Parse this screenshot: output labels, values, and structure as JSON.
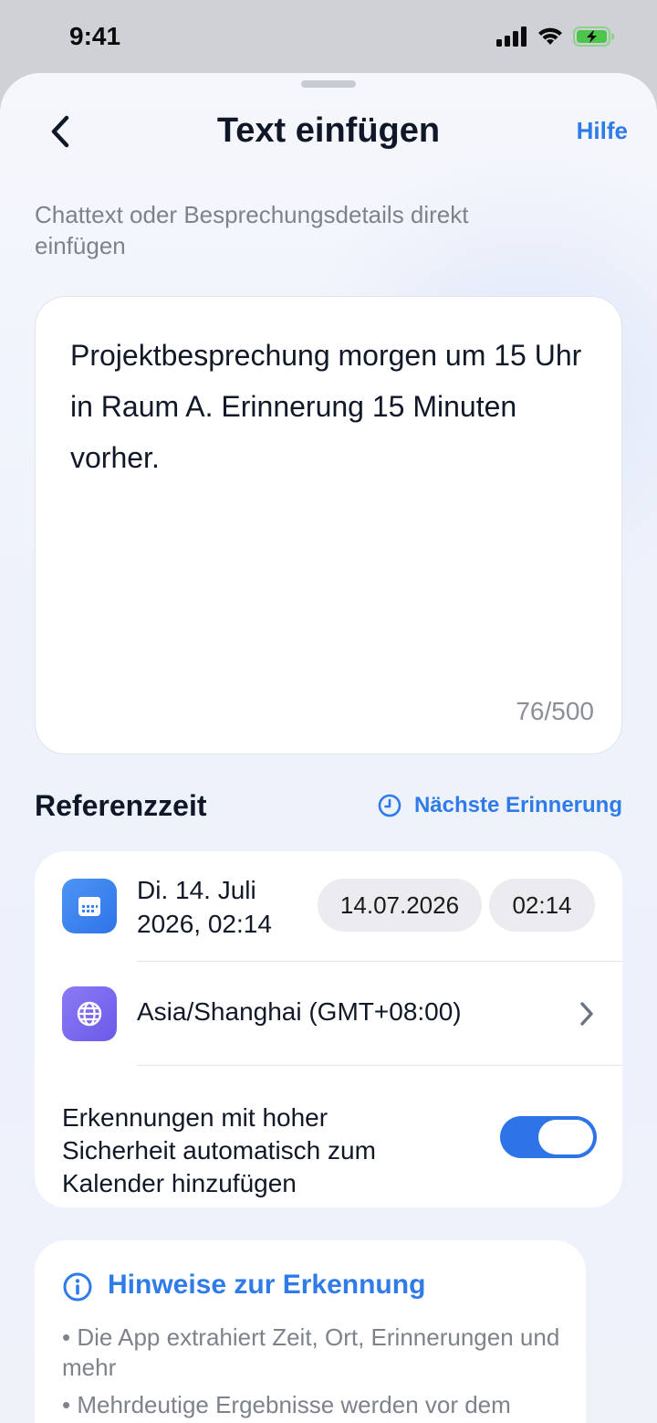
{
  "status_bar": {
    "time": "9:41"
  },
  "header": {
    "title": "Text einfügen",
    "help_label": "Hilfe"
  },
  "subtitle": "Chattext oder Besprechungsdetails direkt einfügen",
  "input": {
    "value": "Projektbesprechung morgen um 15 Uhr in Raum A. Erinnerung 15 Minuten vorher.",
    "counter": "76/500"
  },
  "reference": {
    "section_title": "Referenzzeit",
    "next_reminder_label": "Nächste Erinnerung",
    "date_display": "Di. 14. Juli 2026, 02:14",
    "date_pill": "14.07.2026",
    "time_pill": "02:14",
    "timezone": "Asia/Shanghai (GMT+08:00)",
    "auto_add_label": "Erkennungen mit hoher Sicherheit automatisch zum Kalender hinzufügen",
    "auto_add_enabled": true
  },
  "hints": {
    "title": "Hinweise zur Erkennung",
    "items": [
      "• Die App extrahiert Zeit, Ort, Erinnerungen und mehr",
      "• Mehrdeutige Ergebnisse werden vor dem"
    ]
  },
  "colors": {
    "accent": "#2f7be8",
    "toggle_on": "#2f73e8",
    "calendar_icon_bg": "#3b82f6",
    "globe_icon_bg": "#7c6cf0"
  },
  "icons": {
    "back": "chevron-left-icon",
    "next_reminder": "clock-icon",
    "date": "calendar-icon",
    "timezone": "globe-icon",
    "timezone_chevron": "chevron-right-icon",
    "hint": "info-icon"
  }
}
